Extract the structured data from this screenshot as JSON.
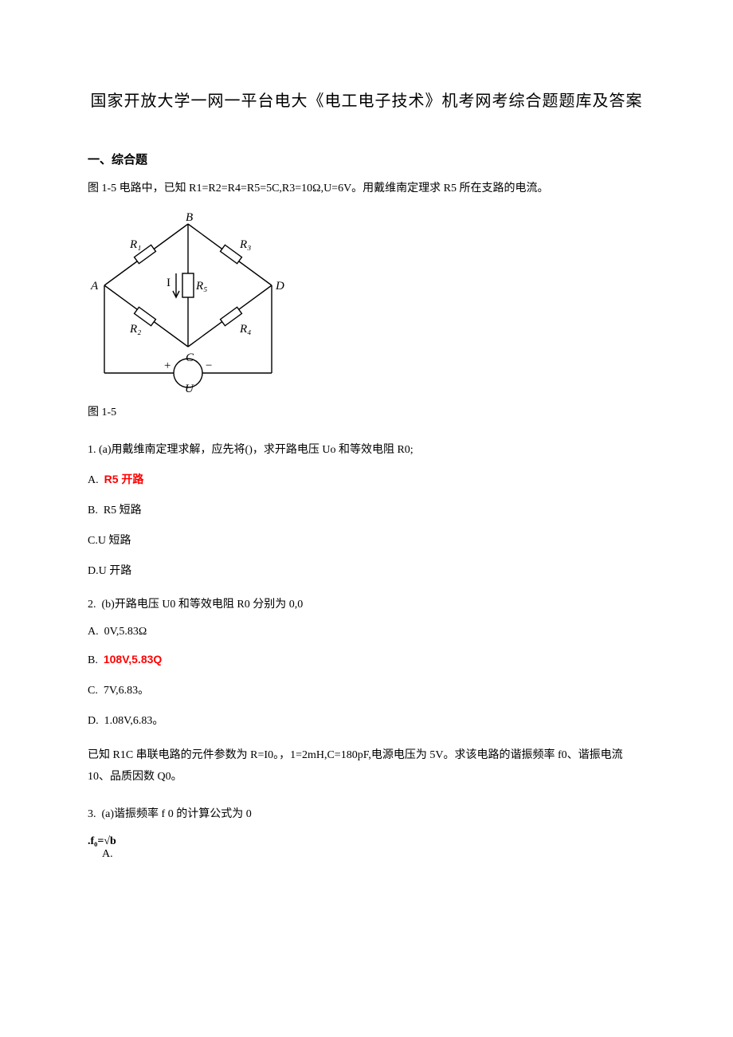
{
  "title": "国家开放大学一网一平台电大《电工电子技术》机考网考综合题题库及答案",
  "section_head": "一、综合题",
  "intro1": "图 1-5 电路中，已知 R1=R2=R4=R5=5C,R3=10Ω,U=6V。用戴维南定理求 R5 所在支路的电流。",
  "diagram_labels": {
    "A": "A",
    "B": "B",
    "C": "C",
    "D": "D",
    "R1": "R₁",
    "R2": "R₂",
    "R3": "R₃",
    "R4": "R₄",
    "R5": "R₅",
    "I": "I",
    "U": "U",
    "plus": "+",
    "minus": "−"
  },
  "fig_caption": "图 1-5",
  "q1": {
    "num": "1.",
    "text": "(a)用戴维南定理求解，应先将()，求开路电压 Uo 和等效电阻 R0;",
    "A": {
      "label": "A.",
      "text": "R5 开路"
    },
    "B": {
      "label": "B.",
      "text": "R5 短路"
    },
    "C": {
      "label": "C.",
      "text": "U 短路"
    },
    "D": {
      "label": "D.",
      "text": "U 开路"
    }
  },
  "q2": {
    "num": "2.",
    "text": "(b)开路电压 U0 和等效电阻 R0 分别为 0,0",
    "A": {
      "label": "A.",
      "text": "0V,5.83Ω"
    },
    "B": {
      "label": "B.",
      "text": "108V,5.83Q"
    },
    "C": {
      "label": "C.",
      "text": "7V,6.83。"
    },
    "D": {
      "label": "D.",
      "text": "1.08V,6.83。"
    }
  },
  "intro2": "已知 R1C 串联电路的元件参数为 R=I0。，1=2mH,C=180pF,电源电压为 5V。求该电路的谐振频率 f0、谐振电流 10、品质因数 Q0。",
  "q3": {
    "num": "3.",
    "text": "(a)谐振频率 f 0 的计算公式为 0",
    "formula": ".f₀=√b",
    "A_label": "A."
  }
}
